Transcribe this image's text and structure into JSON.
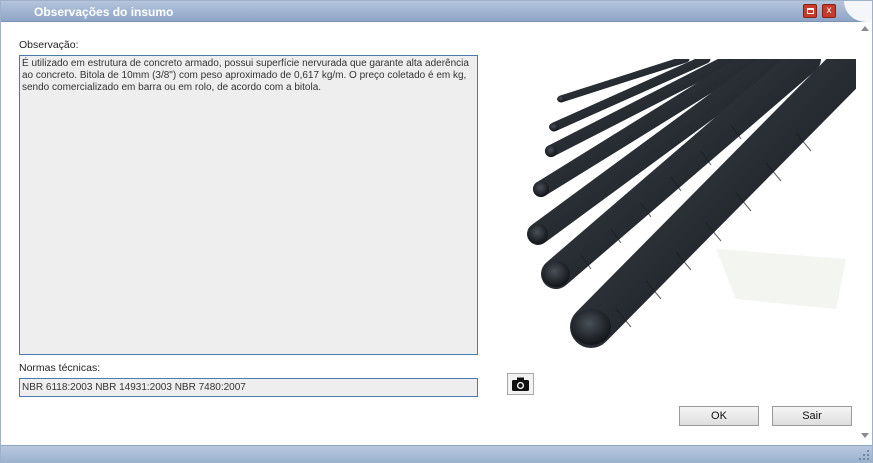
{
  "window": {
    "title": "Observações do insumo",
    "maximize_icon": "maximize-icon",
    "close_icon": "close-icon",
    "close_glyph": "x"
  },
  "observacao": {
    "label": "Observação:",
    "text": "É utilizado em estrutura de concreto armado, possui superfície nervurada que garante alta aderência ao concreto. Bitola de 10mm (3/8\") com peso aproximado de 0,617 kg/m. O preço coletado é em kg, sendo comercializado em barra ou em rolo, de acordo com a bitola."
  },
  "normas": {
    "label": "Normas técnicas:",
    "value": "NBR 6118:2003 NBR 14931:2003  NBR 7480:2007"
  },
  "image": {
    "subject": "steel-rebar-photo",
    "camera_icon": "camera-icon"
  },
  "buttons": {
    "ok": "OK",
    "sair": "Sair"
  },
  "colors": {
    "titlebar": "#8ea5c6",
    "field_border": "#4a7bb0",
    "close_red": "#c83a2c"
  }
}
